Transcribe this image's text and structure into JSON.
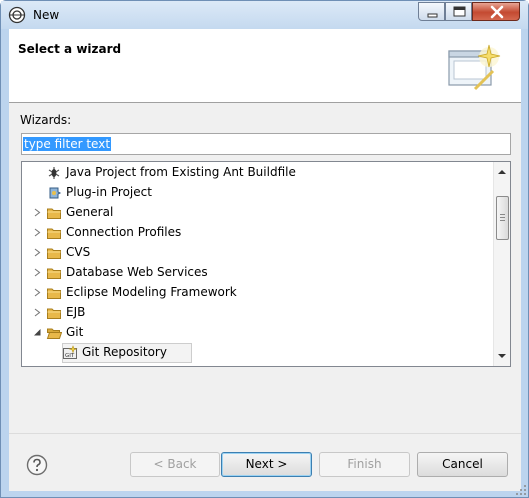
{
  "window": {
    "title": "New"
  },
  "header": {
    "title": "Select a wizard"
  },
  "wizards": {
    "label": "Wizards:",
    "filter_value": "type filter text",
    "items": [
      {
        "label": "Java Project from Existing Ant Buildfile",
        "icon": "ant-icon",
        "expandable": false,
        "expanded": false
      },
      {
        "label": "Plug-in Project",
        "icon": "plugin-icon",
        "expandable": false,
        "expanded": false
      },
      {
        "label": "General",
        "icon": "folder-icon",
        "expandable": true,
        "expanded": false
      },
      {
        "label": "Connection Profiles",
        "icon": "folder-icon",
        "expandable": true,
        "expanded": false
      },
      {
        "label": "CVS",
        "icon": "folder-icon",
        "expandable": true,
        "expanded": false
      },
      {
        "label": "Database Web Services",
        "icon": "folder-icon",
        "expandable": true,
        "expanded": false
      },
      {
        "label": "Eclipse Modeling Framework",
        "icon": "folder-icon",
        "expandable": true,
        "expanded": false
      },
      {
        "label": "EJB",
        "icon": "folder-icon",
        "expandable": true,
        "expanded": false
      },
      {
        "label": "Git",
        "icon": "folder-open-icon",
        "expandable": true,
        "expanded": true
      },
      {
        "label": "Git Repository",
        "icon": "git-repository-icon",
        "expandable": false,
        "expanded": false,
        "selected": true
      }
    ]
  },
  "buttons": {
    "back": "< Back",
    "next": "Next >",
    "finish": "Finish",
    "cancel": "Cancel"
  },
  "colors": {
    "selection": "#3399ff",
    "folder": "#e8b84a"
  }
}
